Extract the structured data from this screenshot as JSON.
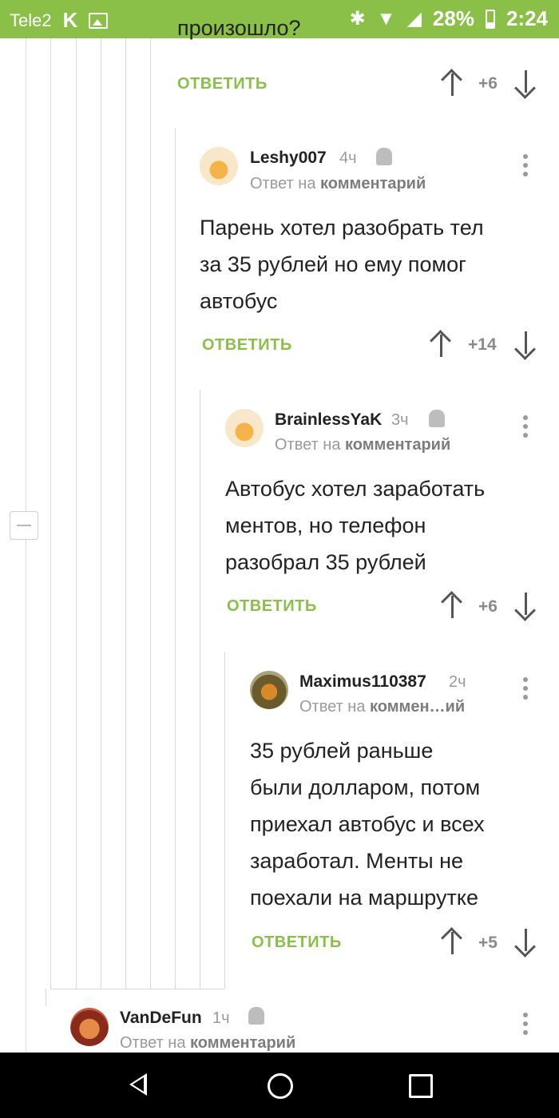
{
  "status_bar": {
    "carrier": "Tele2",
    "app_icon_letter": "K",
    "battery": "28%",
    "time": "2:24"
  },
  "partial_comment": {
    "text_fragment": "произошло?",
    "reply_label": "ОТВЕТИТЬ",
    "score": "+6"
  },
  "comments": [
    {
      "username": "Leshy007",
      "time": "4ч",
      "reply_to_prefix": "Ответ на",
      "reply_to_link": "комментарий",
      "lines": [
        "Парень хотел разобрать тел",
        "за 35 рублей но ему помог",
        "автобус"
      ],
      "reply_label": "ОТВЕТИТЬ",
      "score": "+14"
    },
    {
      "username": "BrainlessYaK",
      "time": "3ч",
      "reply_to_prefix": "Ответ на",
      "reply_to_link": "комментарий",
      "lines": [
        "Автобус хотел заработать",
        "ментов, но телефон",
        "разобрал 35 рублей"
      ],
      "reply_label": "ОТВЕТИТЬ",
      "score": "+6"
    },
    {
      "username": "Maximus110387",
      "time": "2ч",
      "reply_to_prefix": "Ответ на",
      "reply_to_link": "коммен…ий",
      "lines": [
        "35 рублей раньше",
        "были долларом, потом",
        "приехал автобус и всех",
        "заработал. Менты не",
        "поехали на маршрутке"
      ],
      "reply_label": "ОТВЕТИТЬ",
      "score": "+5"
    },
    {
      "username": "VanDeFun",
      "time": "1ч",
      "reply_to_prefix": "Ответ на",
      "reply_to_link": "комментарий"
    }
  ]
}
